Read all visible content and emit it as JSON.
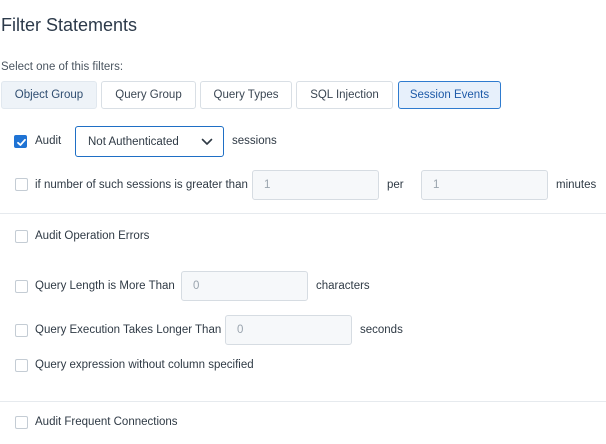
{
  "header": {
    "title": "Filter Statements",
    "subtitle": "Select one of this filters:"
  },
  "tabs": [
    {
      "label": "Object Group"
    },
    {
      "label": "Query Group"
    },
    {
      "label": "Query Types"
    },
    {
      "label": "SQL Injection"
    },
    {
      "label": "Session Events"
    }
  ],
  "audit": {
    "label": "Audit",
    "checked": true,
    "selected_value": "Not Authenticated",
    "suffix": "sessions"
  },
  "threshold": {
    "label": "if number of such sessions is greater than",
    "value1": "1",
    "per_label": "per",
    "value2": "1",
    "unit": "minutes"
  },
  "operation_errors": {
    "label": "Audit Operation Errors"
  },
  "query_length": {
    "label": "Query Length is More Than",
    "value": "0",
    "unit": "characters"
  },
  "query_execution": {
    "label": "Query Execution Takes Longer Than",
    "value": "0",
    "unit": "seconds"
  },
  "no_column": {
    "label": "Query expression without column specified"
  },
  "frequent_connections": {
    "label": "Audit Frequent Connections"
  },
  "colors": {
    "accent": "#1f73d4",
    "active_tab_border": "#2e7bcf"
  },
  "icons": {
    "checkbox": "check-icon",
    "dropdown": "chevron-down-icon"
  }
}
